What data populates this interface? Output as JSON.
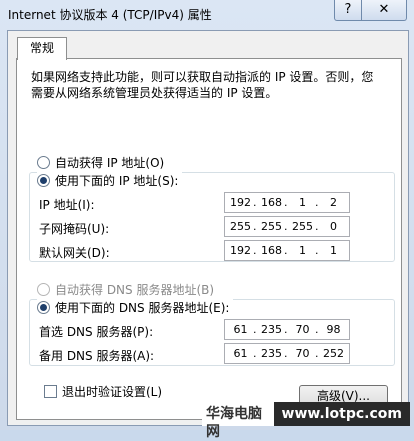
{
  "window": {
    "title": "Internet 协议版本 4 (TCP/IPv4) 属性",
    "help_label": "?",
    "close_label": "✕"
  },
  "tabs": [
    {
      "label": "常规"
    }
  ],
  "description": "如果网络支持此功能，则可以获取自动指派的 IP 设置。否则，您需要从网络系统管理员处获得适当的 IP 设置。",
  "ip_section": {
    "auto_label": "自动获得 IP 地址(O)",
    "manual_label": "使用下面的 IP 地址(S):",
    "selected": "manual",
    "fields": [
      {
        "label": "IP 地址(I):",
        "octets": [
          "192",
          "168",
          "1",
          "2"
        ]
      },
      {
        "label": "子网掩码(U):",
        "octets": [
          "255",
          "255",
          "255",
          "0"
        ]
      },
      {
        "label": "默认网关(D):",
        "octets": [
          "192",
          "168",
          "1",
          "1"
        ]
      }
    ]
  },
  "dns_section": {
    "auto_label": "自动获得 DNS 服务器地址(B)",
    "manual_label": "使用下面的 DNS 服务器地址(E):",
    "selected": "manual",
    "fields": [
      {
        "label": "首选 DNS 服务器(P):",
        "octets": [
          "61",
          "235",
          "70",
          "98"
        ]
      },
      {
        "label": "备用 DNS 服务器(A):",
        "octets": [
          "61",
          "235",
          "70",
          "252"
        ]
      }
    ]
  },
  "validate_label": "退出时验证设置(L)",
  "advanced_label": "高级(V)...",
  "watermark": {
    "left": "华海电脑网",
    "right": "www.lotpc.com"
  }
}
